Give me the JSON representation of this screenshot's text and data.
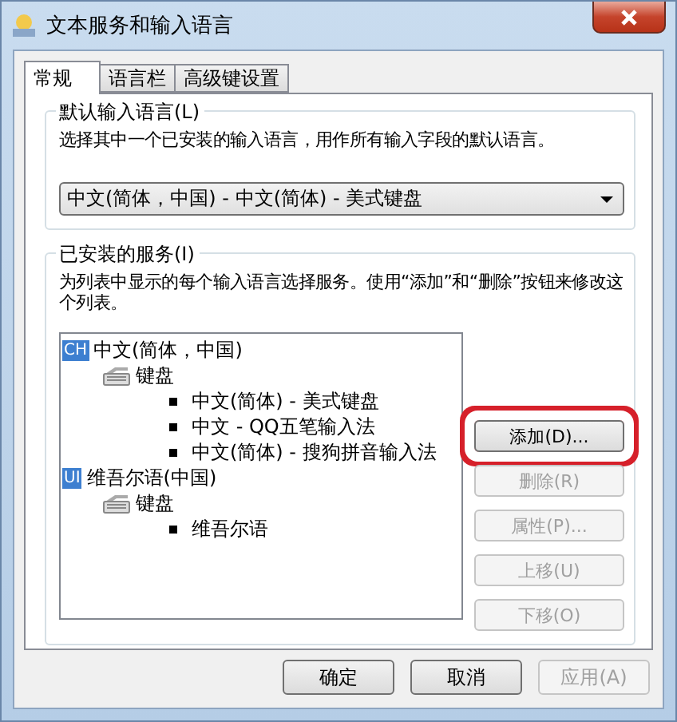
{
  "window": {
    "title": "文本服务和输入语言"
  },
  "tabs": [
    {
      "label": "常规",
      "selected": true
    },
    {
      "label": "语言栏",
      "selected": false
    },
    {
      "label": "高级键设置",
      "selected": false
    }
  ],
  "default_language": {
    "title": "默认输入语言(L)",
    "description": "选择其中一个已安装的输入语言，用作所有输入字段的默认语言。",
    "dropdown": {
      "value": "中文(简体，中国) - 中文(简体) - 美式键盘"
    }
  },
  "installed_services": {
    "title": "已安装的服务(I)",
    "description": "为列表中显示的每个输入语言选择服务。使用“添加”和“删除”按钮来修改这个列表。",
    "tree": [
      {
        "kind": "language",
        "badge": "CH",
        "label": "中文(简体，中国)",
        "children": [
          {
            "kind": "category",
            "label": "键盘",
            "children": [
              {
                "kind": "service",
                "label": "中文(简体) - 美式键盘"
              },
              {
                "kind": "service",
                "label": "中文 - QQ五笔输入法"
              },
              {
                "kind": "service",
                "label": "中文(简体) - 搜狗拼音输入法"
              }
            ]
          }
        ]
      },
      {
        "kind": "language",
        "badge": "UI",
        "label": "维吾尔语(中国)",
        "children": [
          {
            "kind": "category",
            "label": "键盘",
            "children": [
              {
                "kind": "service",
                "label": "维吾尔语"
              }
            ]
          }
        ]
      }
    ],
    "buttons": [
      {
        "label": "添加(D)...",
        "disabled": false,
        "highlighted": true
      },
      {
        "label": "删除(R)",
        "disabled": true,
        "highlighted": false
      },
      {
        "label": "属性(P)...",
        "disabled": true,
        "highlighted": false
      },
      {
        "label": "上移(U)",
        "disabled": true,
        "highlighted": false
      },
      {
        "label": "下移(O)",
        "disabled": true,
        "highlighted": false
      }
    ]
  },
  "footer_buttons": [
    {
      "label": "确定",
      "disabled": false
    },
    {
      "label": "取消",
      "disabled": false
    },
    {
      "label": "应用(A)",
      "disabled": true
    }
  ]
}
